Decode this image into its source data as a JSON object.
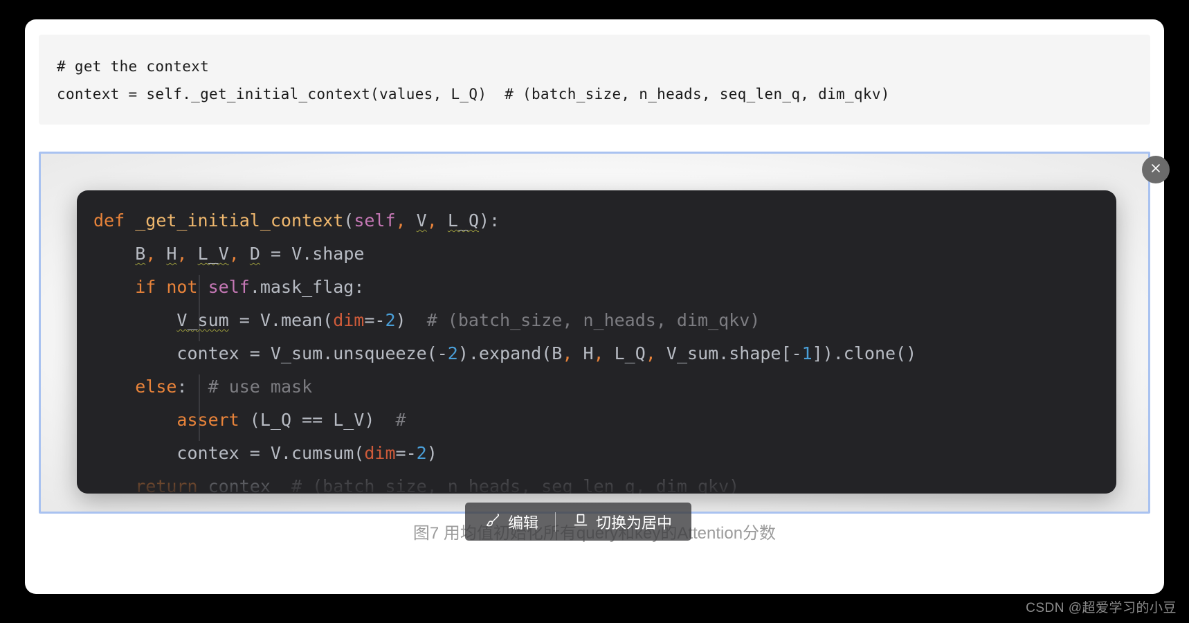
{
  "colors": {
    "page_background": "#000000",
    "sheet_background": "#ffffff",
    "top_code_background": "#f5f5f5",
    "selection_border": "#a9c2f0",
    "dark_code_background": "#232326",
    "toolbar_background": "rgba(60,60,62,0.80)",
    "close_button": "#6b6b6b",
    "caption_text": "#9b9b9b",
    "watermark_text": "#8d8d8d",
    "keyword": "#e8833a",
    "function_name": "#f0b86e",
    "self_token": "#c678b6",
    "number": "#4a9fd8",
    "comment": "#7d7d82",
    "kwarg": "#cf5b3a",
    "plain_text": "#c8ccd4",
    "squiggle": "#9a9a3c"
  },
  "top_code_block": {
    "lines": [
      "# get the context",
      "context = self._get_initial_context(values, L_Q)  # (batch_size, n_heads, seq_len_q, dim_qkv)"
    ]
  },
  "dark_code_card": {
    "language": "python",
    "lines": [
      {
        "indent": 0,
        "tokens": [
          {
            "text": "def",
            "type": "keyword"
          },
          {
            "text": " ",
            "type": "plain"
          },
          {
            "text": "_get_initial_context",
            "type": "function_name"
          },
          {
            "text": "(",
            "type": "plain"
          },
          {
            "text": "self",
            "type": "self"
          },
          {
            "text": ",",
            "type": "operator"
          },
          {
            "text": " ",
            "type": "plain"
          },
          {
            "text": "V",
            "type": "plain_squiggle"
          },
          {
            "text": ",",
            "type": "operator"
          },
          {
            "text": " ",
            "type": "plain"
          },
          {
            "text": "L_Q",
            "type": "plain_squiggle"
          },
          {
            "text": "):",
            "type": "plain"
          }
        ]
      },
      {
        "indent": 1,
        "tokens": [
          {
            "text": "B",
            "type": "plain_squiggle"
          },
          {
            "text": ",",
            "type": "operator"
          },
          {
            "text": " ",
            "type": "plain"
          },
          {
            "text": "H",
            "type": "plain_squiggle"
          },
          {
            "text": ",",
            "type": "operator"
          },
          {
            "text": " ",
            "type": "plain"
          },
          {
            "text": "L_V",
            "type": "plain_squiggle"
          },
          {
            "text": ",",
            "type": "operator"
          },
          {
            "text": " ",
            "type": "plain"
          },
          {
            "text": "D",
            "type": "plain_squiggle"
          },
          {
            "text": " = V.shape",
            "type": "plain"
          }
        ]
      },
      {
        "indent": 1,
        "tokens": [
          {
            "text": "if not",
            "type": "keyword"
          },
          {
            "text": " ",
            "type": "plain"
          },
          {
            "text": "self",
            "type": "self"
          },
          {
            "text": ".mask_flag:",
            "type": "plain"
          }
        ]
      },
      {
        "indent": 2,
        "tokens": [
          {
            "text": "V_sum",
            "type": "plain_squiggle"
          },
          {
            "text": " = V.mean(",
            "type": "plain"
          },
          {
            "text": "dim",
            "type": "kwarg"
          },
          {
            "text": "=-",
            "type": "plain"
          },
          {
            "text": "2",
            "type": "number"
          },
          {
            "text": ")",
            "type": "plain"
          },
          {
            "text": "  # (batch_size, n_heads, dim_qkv)",
            "type": "comment"
          }
        ]
      },
      {
        "indent": 2,
        "tokens": [
          {
            "text": "contex = V_sum.unsqueeze(-",
            "type": "plain"
          },
          {
            "text": "2",
            "type": "number"
          },
          {
            "text": ").expand(B",
            "type": "plain"
          },
          {
            "text": ",",
            "type": "operator"
          },
          {
            "text": " H",
            "type": "plain"
          },
          {
            "text": ",",
            "type": "operator"
          },
          {
            "text": " L_Q",
            "type": "plain"
          },
          {
            "text": ",",
            "type": "operator"
          },
          {
            "text": " V_sum.shape[-",
            "type": "plain"
          },
          {
            "text": "1",
            "type": "number"
          },
          {
            "text": "]).clone()",
            "type": "plain"
          }
        ]
      },
      {
        "indent": 1,
        "tokens": [
          {
            "text": "else",
            "type": "keyword"
          },
          {
            "text": ":",
            "type": "plain"
          },
          {
            "text": "  # use mask",
            "type": "comment"
          }
        ]
      },
      {
        "indent": 2,
        "tokens": [
          {
            "text": "assert",
            "type": "keyword"
          },
          {
            "text": " (L_Q == L_V)",
            "type": "plain"
          },
          {
            "text": "  #",
            "type": "comment"
          }
        ]
      },
      {
        "indent": 2,
        "tokens": [
          {
            "text": "contex = V.cumsum(",
            "type": "plain"
          },
          {
            "text": "dim",
            "type": "kwarg"
          },
          {
            "text": "=-",
            "type": "plain"
          },
          {
            "text": "2",
            "type": "number"
          },
          {
            "text": ")",
            "type": "plain"
          }
        ]
      },
      {
        "indent": 1,
        "tokens": [
          {
            "text": "return",
            "type": "keyword"
          },
          {
            "text": " contex",
            "type": "plain"
          },
          {
            "text": "  # (batch_size, n_heads, seq_len_q, dim_qkv)",
            "type": "comment"
          }
        ]
      }
    ]
  },
  "toolbar": {
    "edit_label": "编辑",
    "edit_icon": "brush-icon",
    "align_label": "切换为居中",
    "align_icon": "align-center-icon"
  },
  "close_button": {
    "icon": "close-icon",
    "label": "×"
  },
  "caption": {
    "text": "图7 用均值初始化所有query和key的Attention分数"
  },
  "watermark": {
    "text": "CSDN @超爱学习的小豆"
  }
}
